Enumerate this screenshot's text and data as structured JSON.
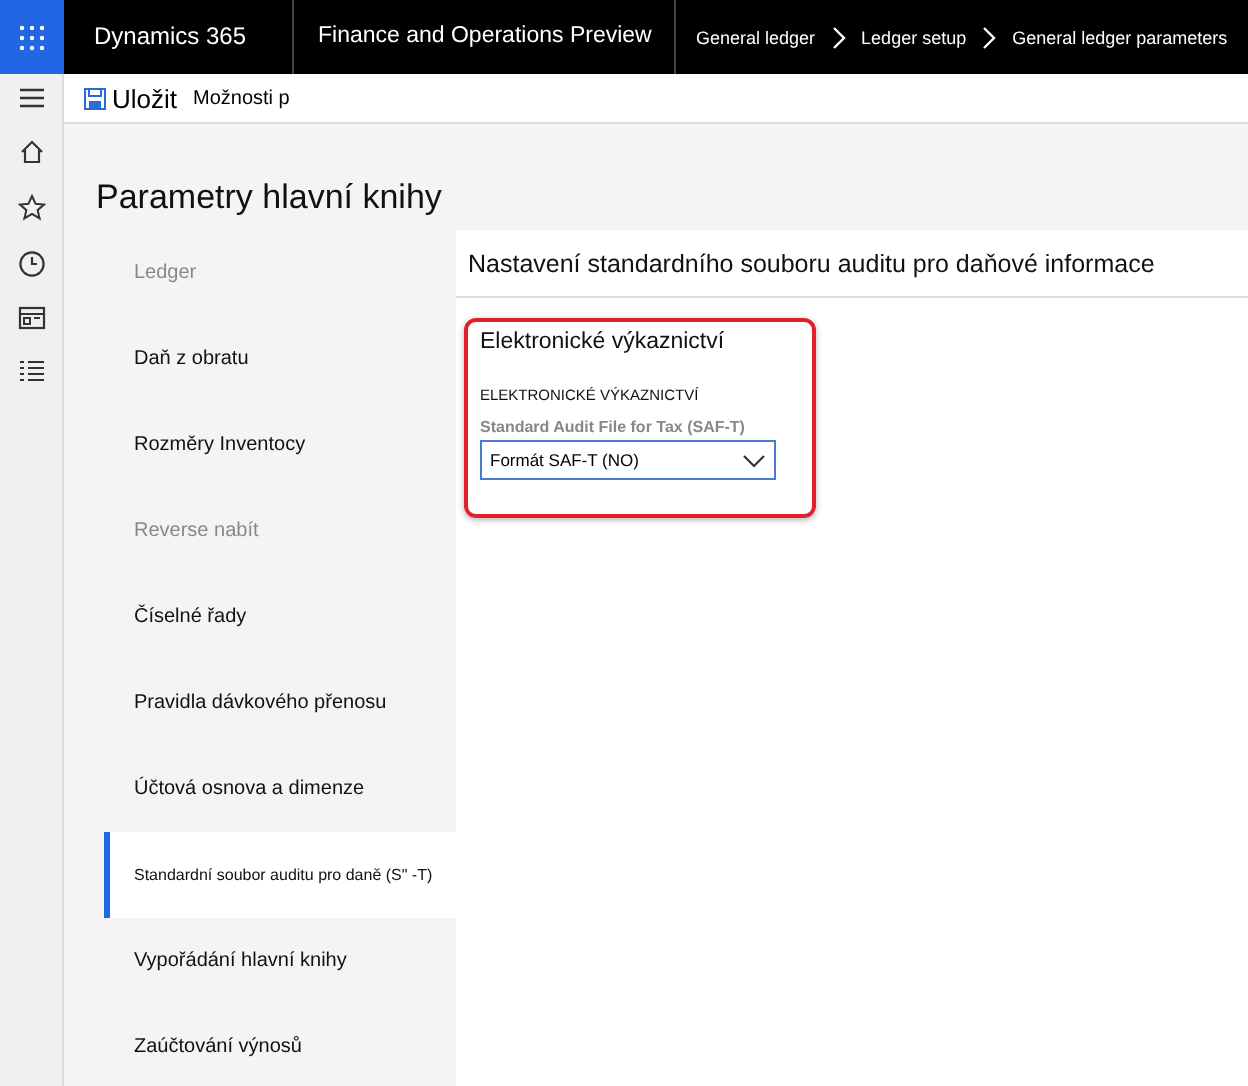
{
  "top_bar": {
    "product": "Dynamics 365",
    "app": "Finance and Operations Preview",
    "breadcrumbs": [
      "General ledger",
      "Ledger setup",
      "General ledger parameters"
    ]
  },
  "toolbar": {
    "save": "Uložit",
    "options": "Možnosti p"
  },
  "page_title": "Parametry hlavní knihy",
  "nav_items": [
    {
      "label": "Ledger",
      "selected": false,
      "dimmed": true
    },
    {
      "label": "Daň z obratu",
      "selected": false,
      "dimmed": false
    },
    {
      "label": "Rozměry Inventocy",
      "selected": false,
      "dimmed": false
    },
    {
      "label": "Reverse nabít",
      "selected": false,
      "dimmed": true
    },
    {
      "label": "Číselné řady",
      "selected": false,
      "dimmed": false
    },
    {
      "label": "Pravidla dávkového přenosu",
      "selected": false,
      "dimmed": false
    },
    {
      "label": "Účtová osnova a dimenze",
      "selected": false,
      "dimmed": false
    },
    {
      "label": "Standardní soubor auditu pro daně (S\" -T)",
      "selected": true,
      "dimmed": false
    },
    {
      "label": "Vypořádání hlavní knihy",
      "selected": false,
      "dimmed": false
    },
    {
      "label": "Zaúčtování výnosů",
      "selected": false,
      "dimmed": false
    }
  ],
  "section_title": "Nastavení standardního souboru auditu pro daňové informace",
  "card": {
    "title": "Elektronické výkaznictví",
    "highlighted": true,
    "group_label": "ELEKTRONICKÉ VÝKAZNICTVÍ",
    "field_label": "Standard Audit File for Tax (SAF-T)",
    "field_value": "Formát SAF-T (NO)"
  }
}
